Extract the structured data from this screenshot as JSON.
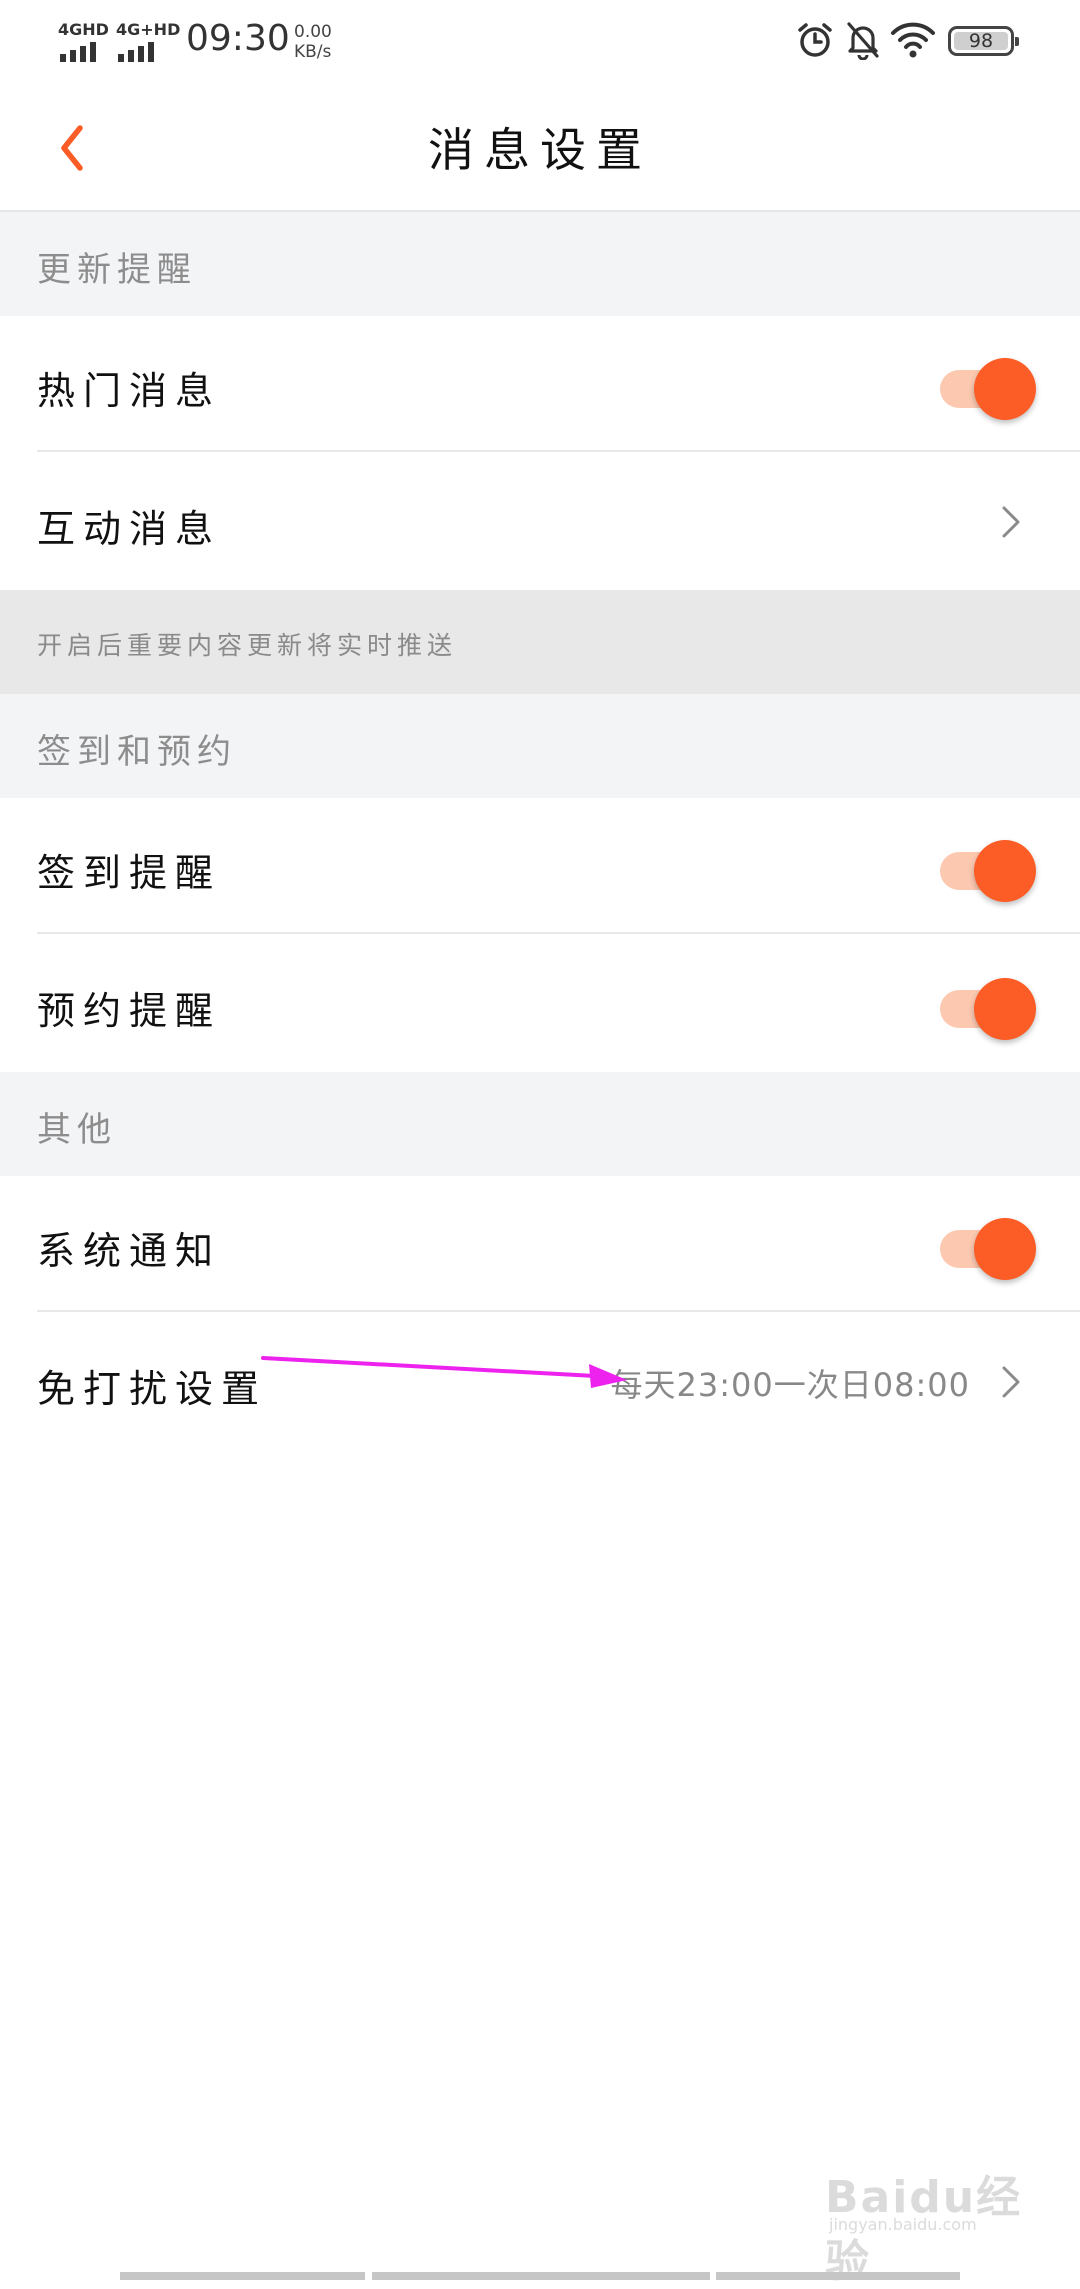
{
  "status_bar": {
    "signal1_label": "4GHD",
    "signal2_label": "4G+HD",
    "time": "09:30",
    "speed_value": "0.00",
    "speed_unit": "KB/s",
    "battery": "98"
  },
  "header": {
    "back_icon": "chevron-left",
    "title": "消息设置",
    "accent_color": "#fc5c25"
  },
  "sections": [
    {
      "header": "更新提醒",
      "items": [
        {
          "label": "热门消息",
          "control": "toggle",
          "on": true
        },
        {
          "label": "互动消息",
          "control": "chevron"
        }
      ],
      "note": "开启后重要内容更新将实时推送"
    },
    {
      "header": "签到和预约",
      "items": [
        {
          "label": "签到提醒",
          "control": "toggle",
          "on": true
        },
        {
          "label": "预约提醒",
          "control": "toggle",
          "on": true
        }
      ]
    },
    {
      "header": "其他",
      "items": [
        {
          "label": "系统通知",
          "control": "toggle",
          "on": true
        },
        {
          "label": "免打扰设置",
          "control": "chevron",
          "value": "每天23:00一次日08:00"
        }
      ]
    }
  ],
  "annotation": {
    "color": "#ee22ee",
    "icon": "arrow-right"
  },
  "watermark": {
    "text": "Baidu经验",
    "sub": "jingyan.baidu.com"
  }
}
